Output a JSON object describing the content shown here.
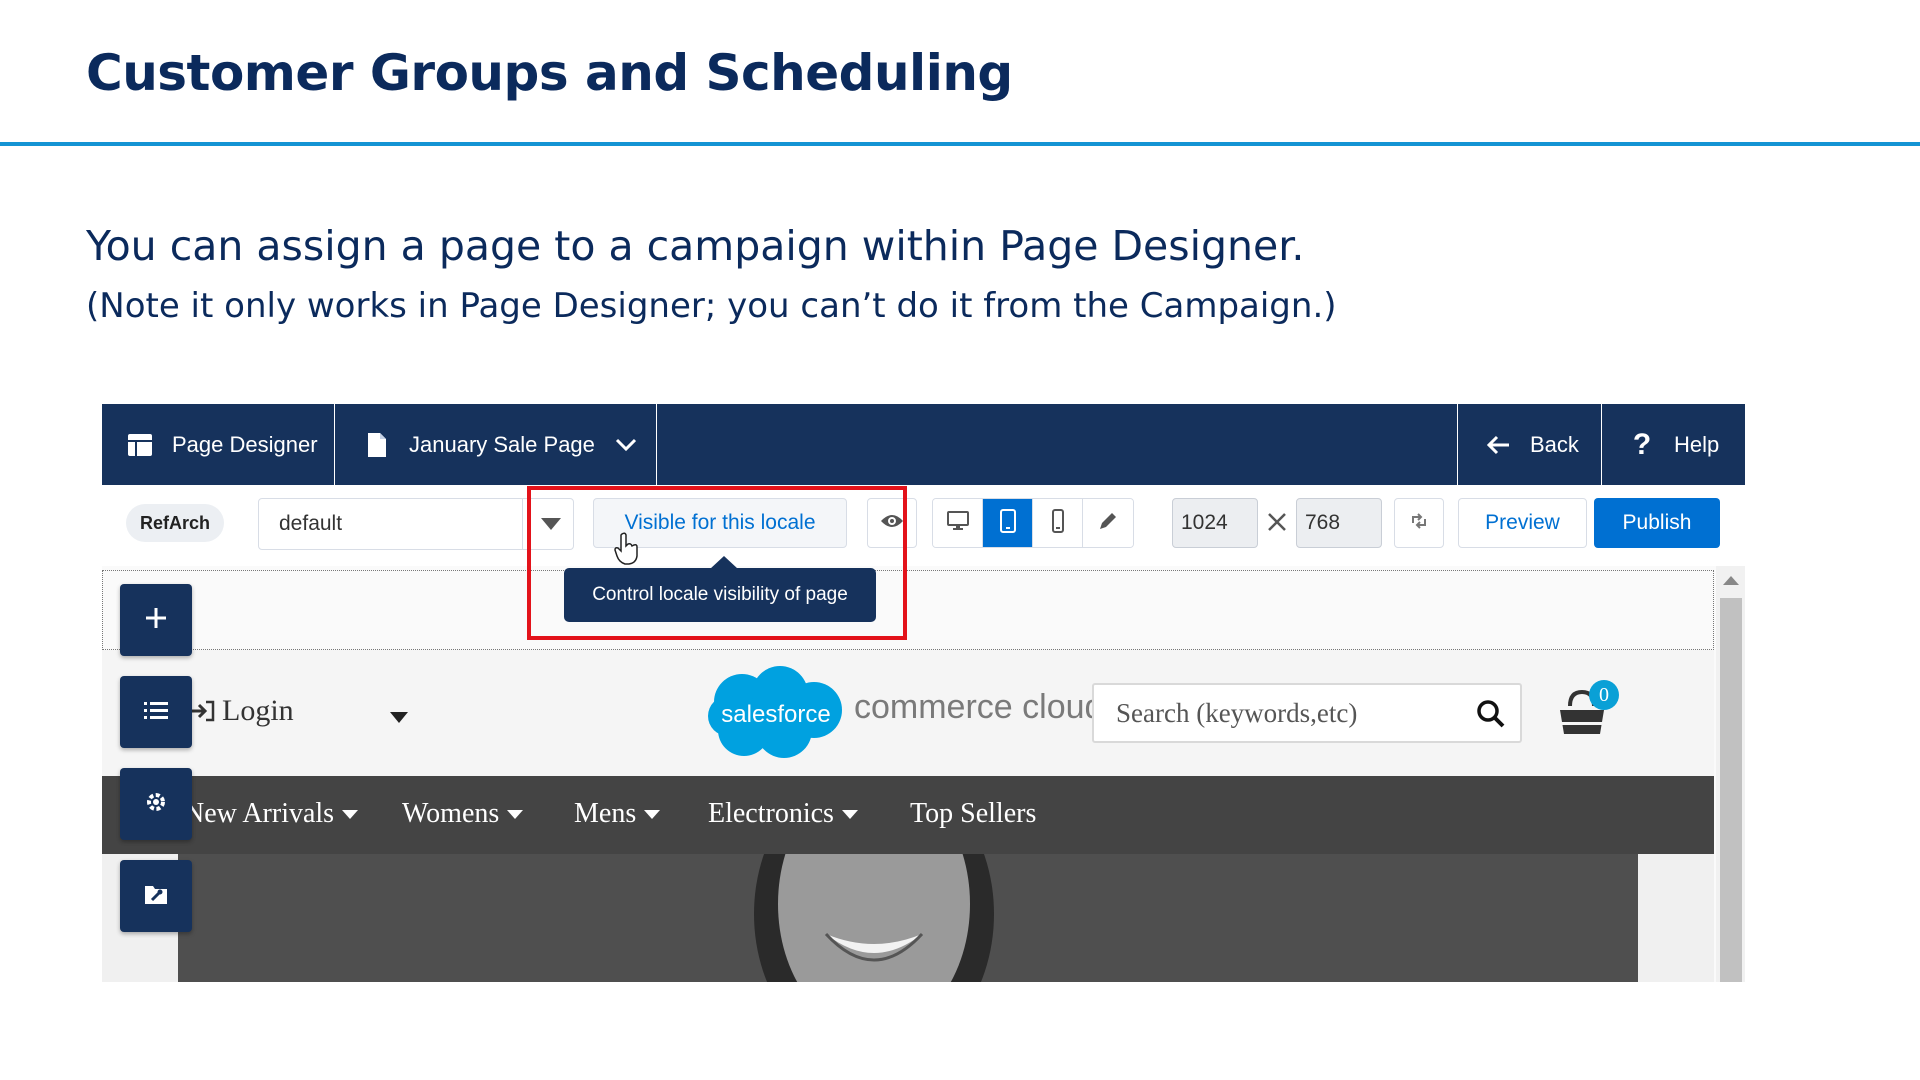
{
  "slide": {
    "title": "Customer Groups and Scheduling",
    "subtitle": "You can assign a page to a campaign within Page Designer.",
    "note": "(Note it only works in Page Designer; you can’t do it from the Campaign.)"
  },
  "topbar": {
    "app_label": "Page Designer",
    "page_label": "January Sale Page",
    "back_label": "Back",
    "help_label": "Help"
  },
  "toolbar": {
    "site_pill": "RefArch",
    "locale_value": "default",
    "visibility_label": "Visible for this locale",
    "width_value": "1024",
    "height_value": "768",
    "preview_label": "Preview",
    "publish_label": "Publish"
  },
  "tooltip": {
    "text": "Control locale visibility of page"
  },
  "storefront": {
    "login_label": "Login",
    "logo_text": "salesforce",
    "brand_text": "commerce cloud",
    "search_placeholder": "Search (keywords,etc)",
    "cart_count": "0",
    "nav": [
      {
        "label": "New Arrivals"
      },
      {
        "label": "Womens"
      },
      {
        "label": "Mens"
      },
      {
        "label": "Electronics"
      },
      {
        "label": "Top Sellers"
      }
    ]
  },
  "colors": {
    "navy": "#16325c",
    "accent_blue": "#0070d2",
    "title_blue": "#0b2a5c",
    "rule_blue": "#1494d4",
    "highlight_red": "#e3121a",
    "nav_gray": "#444444"
  }
}
